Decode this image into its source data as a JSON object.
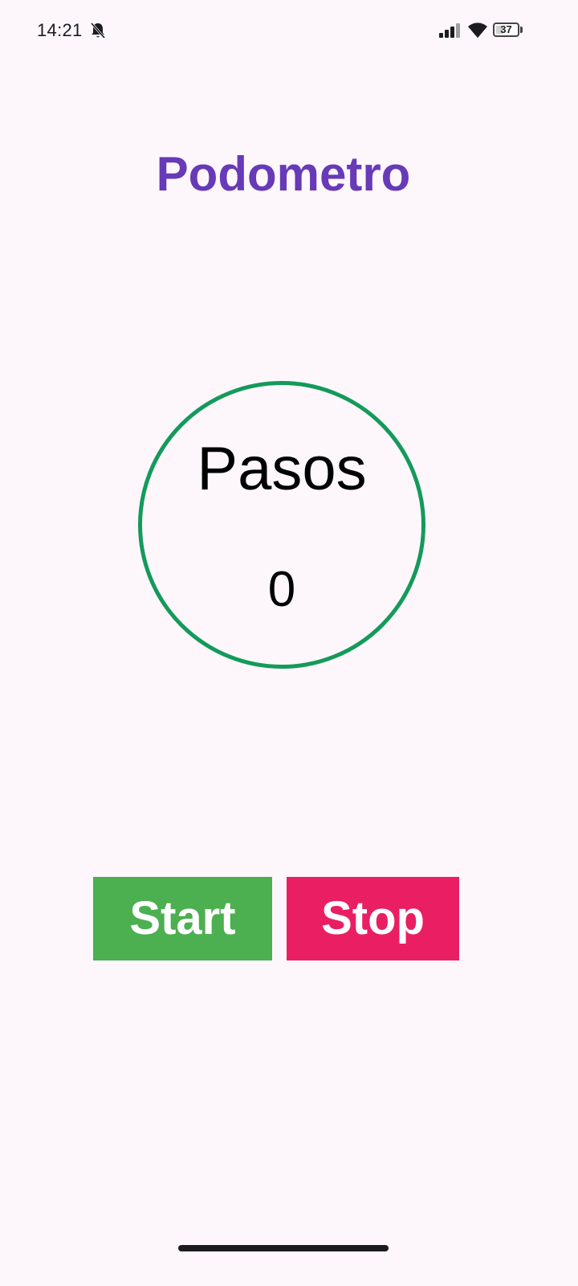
{
  "status_bar": {
    "time": "14:21",
    "battery_level": "37",
    "battery_fraction": 0.37,
    "icons": [
      "muted-bell-icon",
      "signal-icon",
      "wifi-icon",
      "battery-icon"
    ]
  },
  "app": {
    "title": "Podometro"
  },
  "counter": {
    "label": "Pasos",
    "value": "0"
  },
  "controls": {
    "start_label": "Start",
    "stop_label": "Stop"
  },
  "colors": {
    "title": "#673ab7",
    "circle_border": "#149a5a",
    "start_button": "#4caf50",
    "stop_button": "#e91e63",
    "background": "#fdf7fc"
  }
}
